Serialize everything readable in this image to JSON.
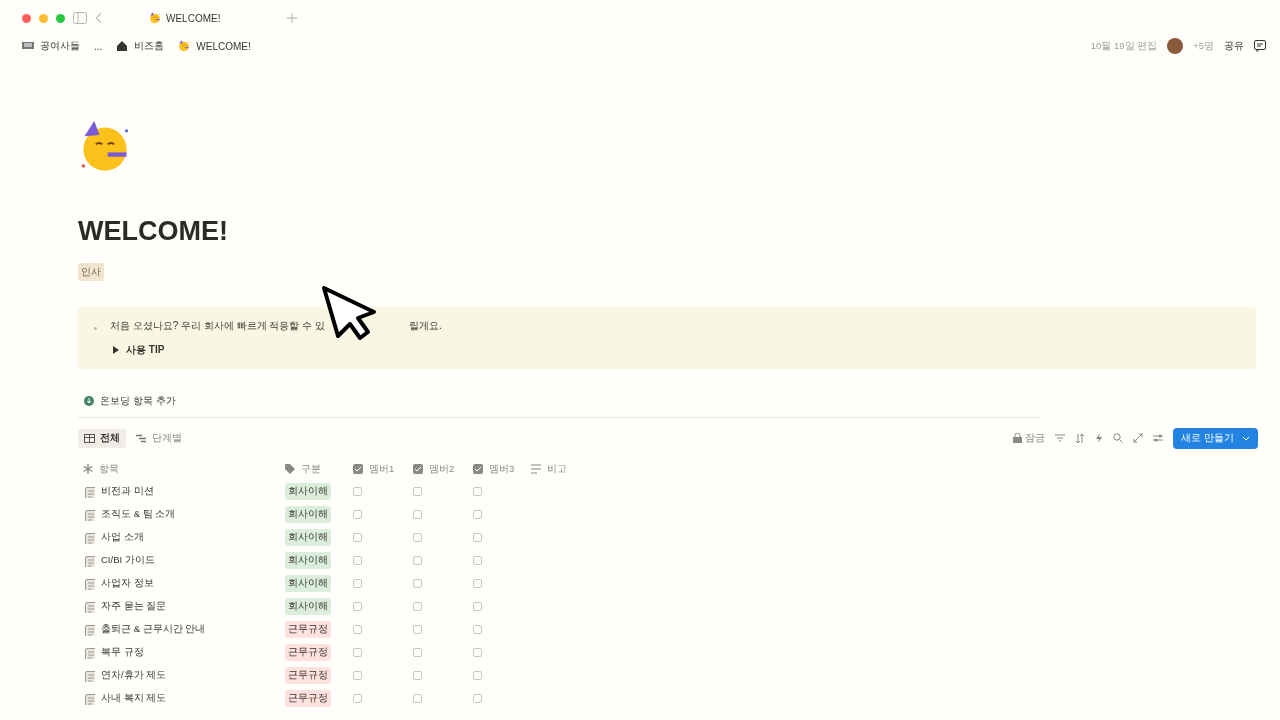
{
  "browser_tab": {
    "title": "WELCOME!",
    "selected": true
  },
  "breadcrumbs": [
    {
      "label": "공여사들"
    },
    {
      "label": "..."
    },
    {
      "label": "비즈홈"
    },
    {
      "label": "WELCOME!"
    }
  ],
  "topbar": {
    "edited": "10월 19일 편집",
    "more_people": "+5명",
    "share": "공유"
  },
  "page": {
    "title": "WELCOME!",
    "tag": "인사"
  },
  "callout": {
    "text_before": "처음 오셨나요? 우리 회사에 빠르게 적응할 수 있",
    "text_after": "릴게요.",
    "toggle": {
      "label": "사용 TIP",
      "expanded": false
    }
  },
  "add_button": "온보딩 항목 추가",
  "views": [
    {
      "label": "전체",
      "selected": true
    },
    {
      "label": "단계별",
      "selected": false
    }
  ],
  "toolbar": {
    "lock": "잠금",
    "new_button": "새로 만들기"
  },
  "table": {
    "columns": [
      {
        "label": "항목",
        "kind": "title"
      },
      {
        "label": "구분",
        "kind": "select"
      },
      {
        "label": "멤버1",
        "kind": "checkbox"
      },
      {
        "label": "멤버2",
        "kind": "checkbox"
      },
      {
        "label": "멤버3",
        "kind": "checkbox"
      },
      {
        "label": "비고",
        "kind": "text"
      }
    ],
    "rows": [
      {
        "title": "비전과 미션",
        "tag": {
          "label": "회사이해",
          "color": "#dbeddb"
        },
        "members": [
          false,
          false,
          false
        ]
      },
      {
        "title": "조직도 & 팀 소개",
        "tag": {
          "label": "회사이해",
          "color": "#dbeddb"
        },
        "members": [
          false,
          false,
          false
        ]
      },
      {
        "title": "사업 소개",
        "tag": {
          "label": "회사이해",
          "color": "#dbeddb"
        },
        "members": [
          false,
          false,
          false
        ]
      },
      {
        "title": "CI/BI 가이드",
        "tag": {
          "label": "회사이해",
          "color": "#dbeddb"
        },
        "members": [
          false,
          false,
          false
        ]
      },
      {
        "title": "사업자 정보",
        "tag": {
          "label": "회사이해",
          "color": "#dbeddb"
        },
        "members": [
          false,
          false,
          false
        ]
      },
      {
        "title": "자주 묻는 질문",
        "tag": {
          "label": "회사이해",
          "color": "#dbeddb"
        },
        "members": [
          false,
          false,
          false
        ]
      },
      {
        "title": "출퇴근 & 근무시간 안내",
        "tag": {
          "label": "근무규정",
          "color": "#ffe2dd"
        },
        "members": [
          false,
          false,
          false
        ]
      },
      {
        "title": "복무 규정",
        "tag": {
          "label": "근무규정",
          "color": "#ffe2dd"
        },
        "members": [
          false,
          false,
          false
        ]
      },
      {
        "title": "연차/휴가 제도",
        "tag": {
          "label": "근무규정",
          "color": "#ffe2dd"
        },
        "members": [
          false,
          false,
          false
        ]
      },
      {
        "title": "사내 복지 제도",
        "tag": {
          "label": "근무규정",
          "color": "#ffe2dd"
        },
        "members": [
          false,
          false,
          false
        ]
      }
    ]
  }
}
